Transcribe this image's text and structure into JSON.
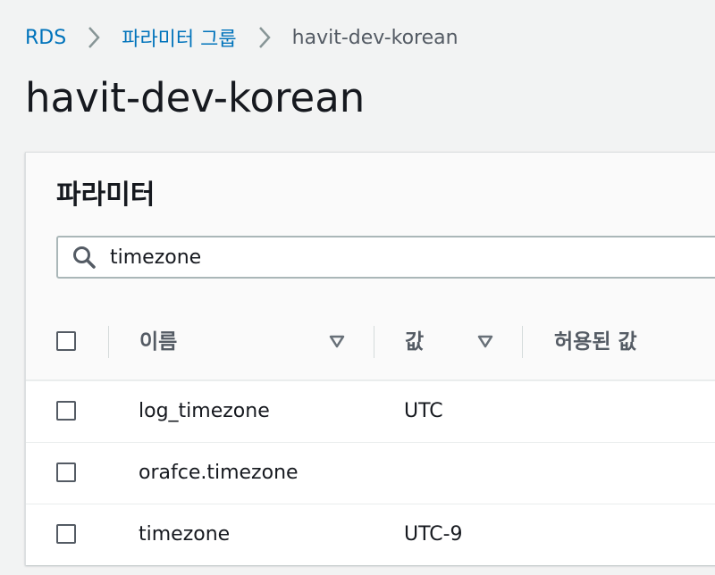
{
  "breadcrumb": {
    "items": [
      {
        "label": "RDS"
      },
      {
        "label": "파라미터 그룹"
      },
      {
        "label": "havit-dev-korean"
      }
    ]
  },
  "page": {
    "title": "havit-dev-korean"
  },
  "panel": {
    "title": "파라미터",
    "search": {
      "value": "timezone",
      "icon": "search-icon"
    },
    "columns": [
      {
        "label": "이름",
        "sortable": true
      },
      {
        "label": "값",
        "sortable": true
      },
      {
        "label": "허용된 값",
        "sortable": false
      }
    ],
    "rows": [
      {
        "name": "log_timezone",
        "value": "UTC",
        "checked": false
      },
      {
        "name": "orafce.timezone",
        "value": "",
        "checked": false
      },
      {
        "name": "timezone",
        "value": "UTC-9",
        "checked": false
      }
    ]
  },
  "colors": {
    "link": "#0073bb",
    "text": "#16191f",
    "muted": "#545b64",
    "background": "#f2f3f3"
  }
}
